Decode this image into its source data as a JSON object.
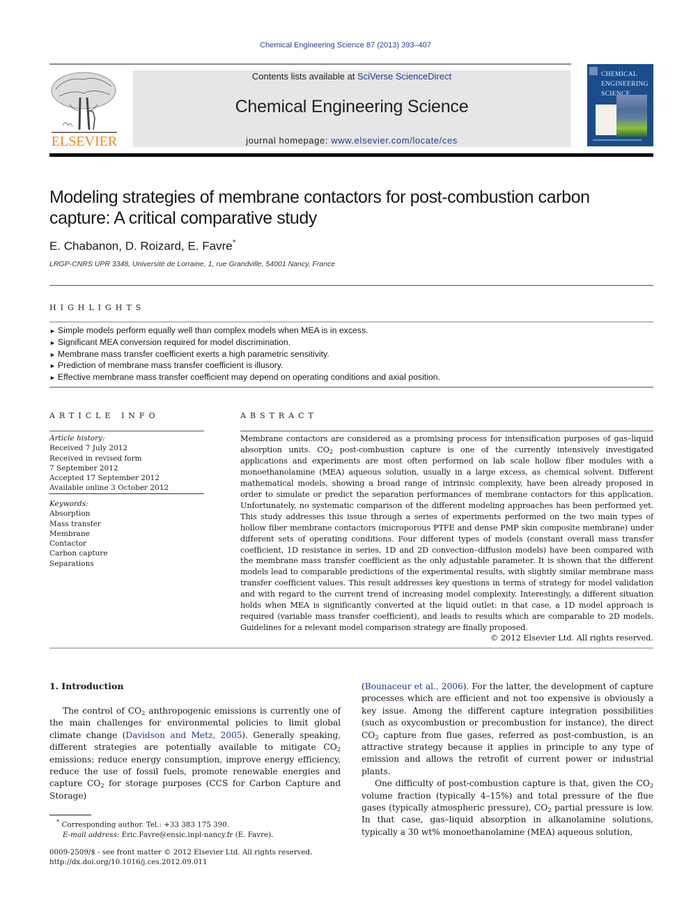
{
  "running_head": "Chemical Engineering Science 87 (2013) 393–407",
  "header": {
    "publisher_logo_text": "ELSEVIER",
    "contents_prefix": "Contents lists available at ",
    "contents_link": "SciVerse ScienceDirect",
    "journal_name": "Chemical Engineering Science",
    "homepage_prefix": "journal homepage: ",
    "homepage_link": "www.elsevier.com/locate/ces",
    "cover_title_lines": [
      "CHEMICAL",
      "ENGINEERING",
      "SCIENCE"
    ],
    "colors": {
      "publisher_orange": "#f08a1c",
      "link_blue": "#1f3a93",
      "banner_gray": "#e6e6e6",
      "cover_blue": "#1a4c8c"
    }
  },
  "article": {
    "title_line1": "Modeling strategies of membrane contactors for post-combustion carbon",
    "title_line2": "capture: A critical comparative study",
    "authors": "E. Chabanon, D. Roizard, E. Favre",
    "corresponding_mark": "*",
    "affiliation": "LRGP-CNRS UPR 3348, Université de Lorraine, 1, rue Grandville, 54001 Nancy, France"
  },
  "highlights": {
    "heading": "HIGHLIGHTS",
    "bullet": "►",
    "items": [
      "Simple models perform equally well than complex models when MEA is in excess.",
      "Significant MEA conversion required for model discrimination.",
      "Membrane mass transfer coefficient exerts a high parametric sensitivity.",
      "Prediction of membrane mass transfer coefficient is illusory.",
      "Effective membrane mass transfer coefficient may depend on operating conditions and axial position."
    ]
  },
  "article_info": {
    "heading": "ARTICLE INFO",
    "history_label": "Article history:",
    "history": [
      "Received 7 July 2012",
      "Received in revised form",
      "7 September 2012",
      "Accepted 17 September 2012",
      "Available online 3 October 2012"
    ],
    "keywords_label": "Keywords:",
    "keywords": [
      "Absorption",
      "Mass transfer",
      "Membrane",
      "Contactor",
      "Carbon capture",
      "Separations"
    ]
  },
  "abstract": {
    "heading": "ABSTRACT",
    "part1": "Membrane contactors are considered as a promising process for intensification purposes of gas–liquid absorption units. CO",
    "sub1": "2",
    "part2": " post-combustion capture is one of the currently intensively investigated applications and experiments are most often performed on lab scale hollow fiber modules with a monoethanolamine (MEA) aqueous solution, usually in a large excess, as chemical solvent. Different mathematical models, showing a broad range of intrinsic complexity, have been already proposed in order to simulate or predict the separation performances of membrane contactors for this application. Unfortunately, no systematic comparison of the different modeling approaches has been performed yet. This study addresses this issue through a series of experiments performed on the two main types of hollow fiber membrane contactors (microporous PTFE and dense PMP skin composite membrane) under different sets of operating conditions. Four different types of models (constant overall mass transfer coefficient, 1D resistance in series, 1D and 2D convection–diffusion models) have been compared with the membrane mass transfer coefficient as the only adjustable parameter. It is shown that the different models lead to comparable predictions of the experimental results, with slightly similar membrane mass transfer coefficient values. This result addresses key questions in terms of strategy for model validation and with regard to the current trend of increasing model complexity. Interestingly, a different situation holds when MEA is significantly converted at the liquid outlet: in that case, a 1D model approach is required (variable mass transfer coefficient), and leads to results which are comparable to 2D models. Guidelines for a relevant model comparison strategy are finally proposed.",
    "copyright": "© 2012 Elsevier Ltd. All rights reserved."
  },
  "body": {
    "section_heading": "1.  Introduction",
    "left": {
      "p1_a": "The control of CO",
      "p1_b": " anthropogenic emissions is currently one of the main challenges for environmental policies to limit global climate change (",
      "cite1": "Davidson and Metz, 2005",
      "p1_c": "). Generally speaking, different strategies are potentially available to mitigate CO",
      "p1_d": " emissions: reduce energy consumption, improve energy efficiency, reduce the use of fossil fuels, promote renewable energies and capture CO",
      "p1_e": " for storage purposes (CCS for Carbon Capture and Storage)"
    },
    "right": {
      "p1_open": "(",
      "cite2": "Bounaceur et al., 2006",
      "p1_a": "). For the latter, the development of capture processes which are efficient and not too expensive is obviously a key issue. Among the different capture integration possibilities (such as oxycombustion or precombustion for instance), the direct CO",
      "p1_b": " capture from flue gases, referred as post-combustion, is an attractive strategy because it applies in principle to any type of emission and allows the retrofit of current power or industrial plants.",
      "p2_a": "One difficulty of post-combustion capture is that, given the CO",
      "p2_b": " volume fraction (typically 4–15%) and total pressure of the flue gases (typically atmospheric pressure), CO",
      "p2_c": " partial pressure is low. In that case, gas–liquid absorption in alkanolamine solutions, typically a 30 wt% monoethanolamine (MEA) aqueous solution,"
    },
    "subscript": "2"
  },
  "footnotes": {
    "mark": "*",
    "corresponding": " Corresponding author. Tel.: +33 383 175 390.",
    "email_label": "E-mail address:",
    "email": " Eric.Favre@ensic.inpl-nancy.fr (E. Favre).",
    "issn": "0009-2509/$ - see front matter © 2012 Elsevier Ltd. All rights reserved.",
    "doi": "http://dx.doi.org/10.1016/j.ces.2012.09.011"
  }
}
